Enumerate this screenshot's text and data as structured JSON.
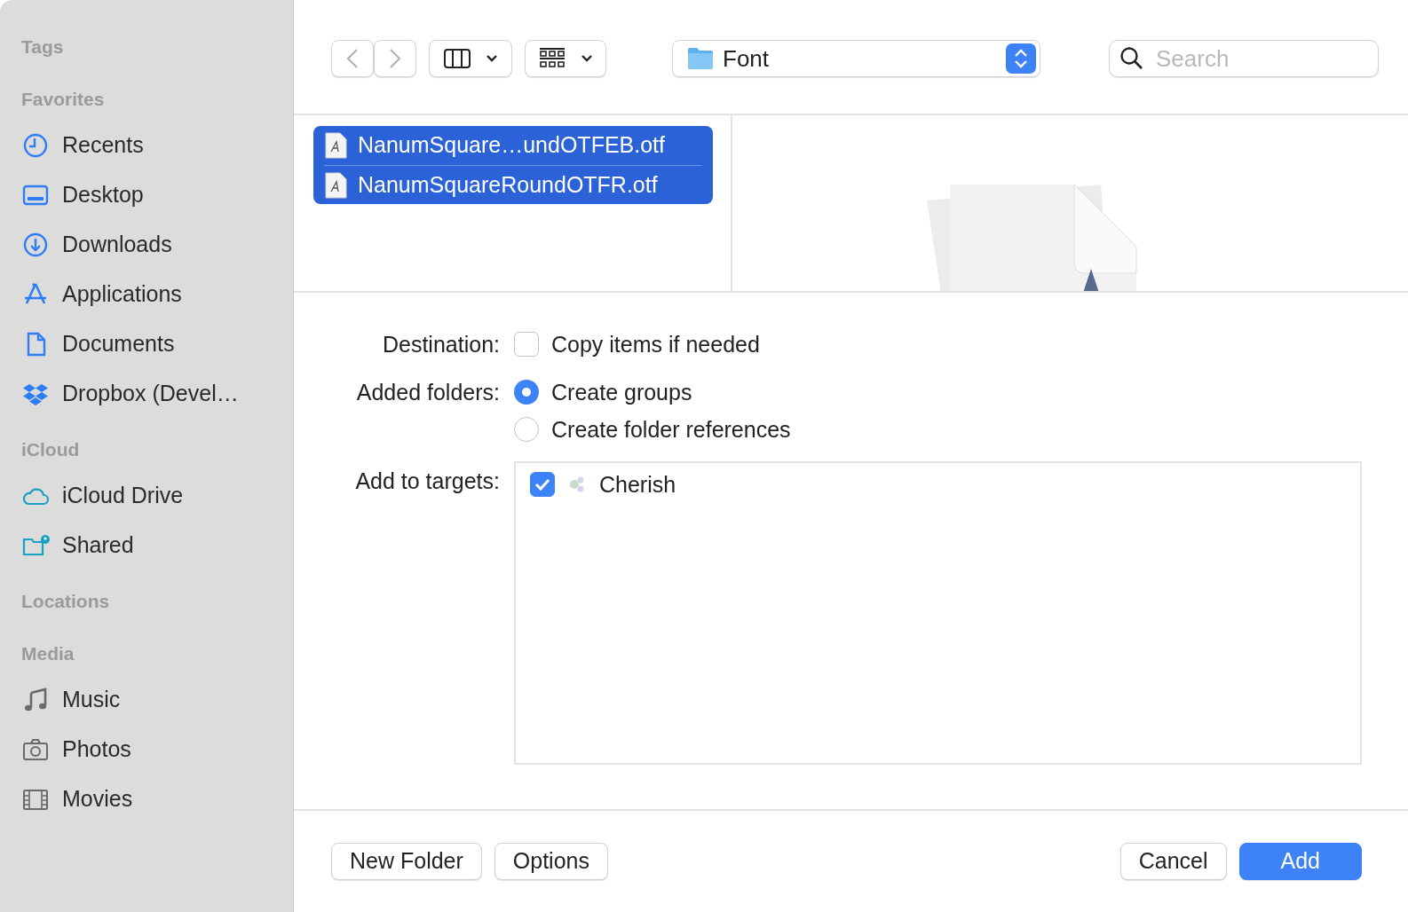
{
  "sidebar": {
    "sections": [
      {
        "title": "Tags"
      },
      {
        "title": "Favorites",
        "items": [
          {
            "label": "Recents"
          },
          {
            "label": "Desktop"
          },
          {
            "label": "Downloads"
          },
          {
            "label": "Applications"
          },
          {
            "label": "Documents"
          },
          {
            "label": "Dropbox (Devel…"
          }
        ]
      },
      {
        "title": "iCloud",
        "items": [
          {
            "label": "iCloud Drive"
          },
          {
            "label": "Shared"
          }
        ]
      },
      {
        "title": "Locations"
      },
      {
        "title": "Media",
        "items": [
          {
            "label": "Music"
          },
          {
            "label": "Photos"
          },
          {
            "label": "Movies"
          }
        ]
      }
    ]
  },
  "toolbar": {
    "location": "Font",
    "search": {
      "placeholder": "Search"
    }
  },
  "files": [
    {
      "name": "NanumSquare…undOTFEB.otf",
      "selected": true
    },
    {
      "name": "NanumSquareRoundOTFR.otf",
      "selected": true
    }
  ],
  "options": {
    "destination": {
      "label": "Destination:",
      "option": {
        "label": "Copy items if needed",
        "checked": false
      }
    },
    "added_folders": {
      "label": "Added folders:",
      "choices": [
        {
          "label": "Create groups",
          "selected": true
        },
        {
          "label": "Create folder references",
          "selected": false
        }
      ]
    },
    "targets": {
      "label": "Add to targets:",
      "items": [
        {
          "name": "Cherish",
          "checked": true
        }
      ]
    }
  },
  "buttons": {
    "left": [
      "New Folder",
      "Options"
    ],
    "right": [
      {
        "label": "Cancel",
        "primary": false
      },
      {
        "label": "Add",
        "primary": true
      }
    ]
  }
}
